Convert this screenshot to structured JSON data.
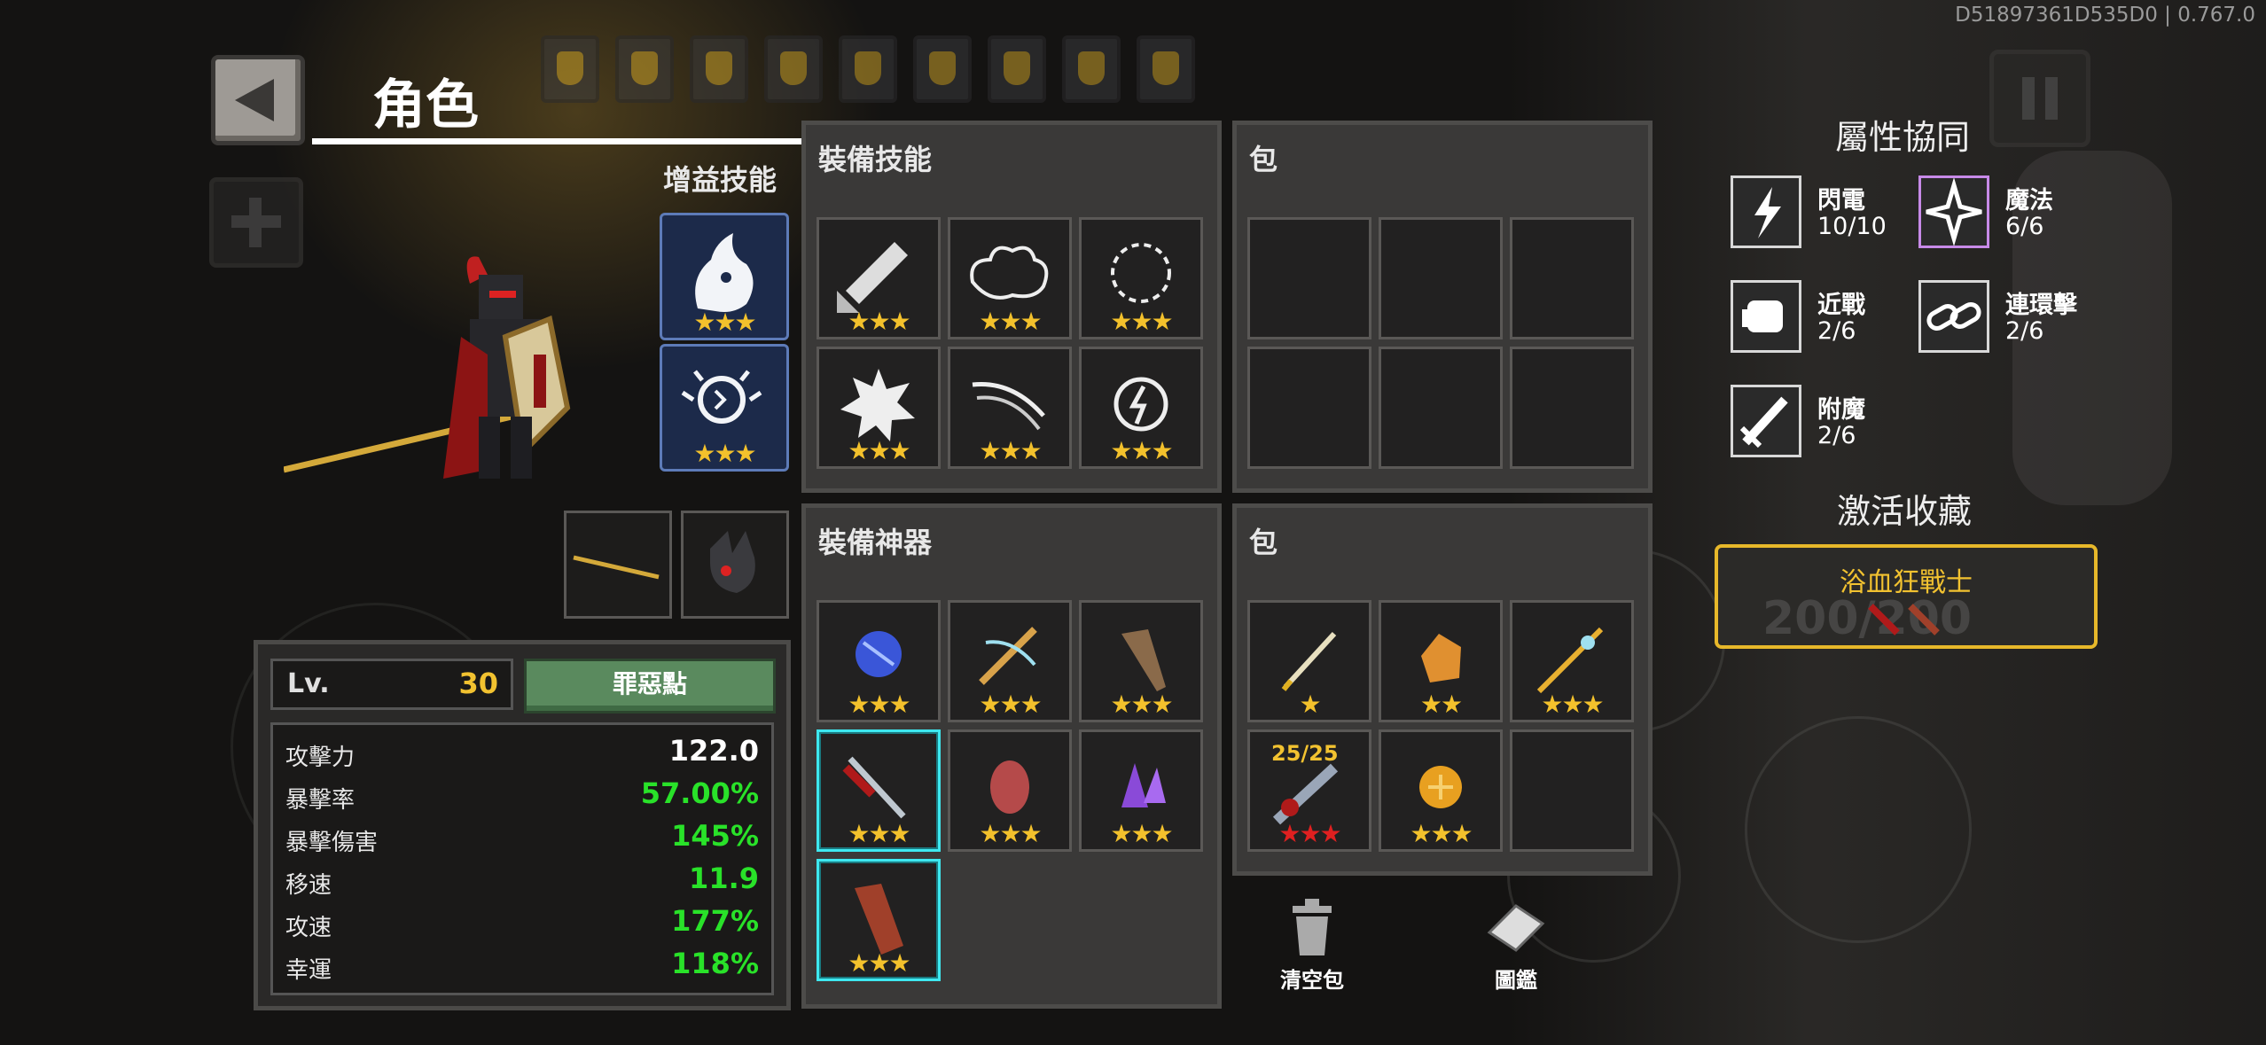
{
  "version_text": "D51897361D535D0 | 0.767.0",
  "screen_title": "角色",
  "buff_skills": {
    "label": "增益技能",
    "slots": [
      {
        "icon": "ghost-flame-icon",
        "stars": "★★★"
      },
      {
        "icon": "spirit-orb-icon",
        "stars": "★★★"
      }
    ]
  },
  "equipped_weapons": [
    {
      "icon": "golden-spear-icon"
    },
    {
      "icon": "shadow-creature-icon"
    }
  ],
  "stats_panel": {
    "level_label": "Lv.",
    "level_value": "30",
    "sin_button": "罪惡點",
    "rows": [
      {
        "name": "攻擊力",
        "value": "122.0",
        "color": "#ffffff"
      },
      {
        "name": "暴擊率",
        "value": "57.00%",
        "color": "#29e229"
      },
      {
        "name": "暴擊傷害",
        "value": "145%",
        "color": "#29e229"
      },
      {
        "name": "移速",
        "value": "11.9",
        "color": "#29e229"
      },
      {
        "name": "攻速",
        "value": "177%",
        "color": "#29e229"
      },
      {
        "name": "幸運",
        "value": "118%",
        "color": "#29e229"
      }
    ]
  },
  "equip_skills": {
    "title": "裝備技能",
    "cells": [
      {
        "icon": "sword-arrow-icon",
        "stars": "★★★"
      },
      {
        "icon": "cloud-burst-icon",
        "stars": "★★★"
      },
      {
        "icon": "energy-ring-icon",
        "stars": "★★★"
      },
      {
        "icon": "spiky-blast-icon",
        "stars": "★★★"
      },
      {
        "icon": "slash-wind-icon",
        "stars": "★★★"
      },
      {
        "icon": "lightning-orb-icon",
        "stars": "★★★"
      }
    ]
  },
  "skill_bag": {
    "title": "包",
    "cells": [
      "",
      "",
      "",
      "",
      "",
      ""
    ]
  },
  "equip_artifacts": {
    "title": "裝備神器",
    "cells": [
      {
        "icon": "blue-crystal-icon",
        "stars": "★★★",
        "selected": false
      },
      {
        "icon": "crossbow-icon",
        "stars": "★★★",
        "selected": false
      },
      {
        "icon": "drill-icon",
        "stars": "★★★",
        "selected": false
      },
      {
        "icon": "blood-sword-icon",
        "stars": "★★★",
        "selected": true
      },
      {
        "icon": "red-egg-icon",
        "stars": "★★★",
        "selected": false
      },
      {
        "icon": "purple-crystal-icon",
        "stars": "★★★",
        "selected": false
      },
      {
        "icon": "leather-glove-icon",
        "stars": "★★★",
        "selected": true
      }
    ]
  },
  "artifact_bag": {
    "title": "包",
    "cells": [
      {
        "icon": "pen-icon",
        "stars": "★",
        "tag": ""
      },
      {
        "icon": "amber-stone-icon",
        "stars": "★★",
        "tag": ""
      },
      {
        "icon": "golden-trident-icon",
        "stars": "★★★",
        "tag": ""
      },
      {
        "icon": "broken-greatsword-icon",
        "stars": "★★★",
        "tag": "25/25",
        "red": true
      },
      {
        "icon": "gold-coin-icon",
        "stars": "★★★",
        "tag": ""
      },
      {
        "icon": "",
        "stars": "",
        "tag": ""
      }
    ]
  },
  "bottom_actions": {
    "clear_bag": "清空包",
    "codex": "圖鑑"
  },
  "synergy": {
    "title": "屬性協同",
    "items": [
      {
        "name": "閃電",
        "count": "10/10",
        "icon": "lightning-icon"
      },
      {
        "name": "魔法",
        "count": "6/6",
        "icon": "magic-star-icon"
      },
      {
        "name": "近戰",
        "count": "2/6",
        "icon": "fist-icon"
      },
      {
        "name": "連環擊",
        "count": "2/6",
        "icon": "chain-icon"
      },
      {
        "name": "附魔",
        "count": "2/6",
        "icon": "enchant-sword-icon"
      }
    ]
  },
  "collection": {
    "title": "激活收藏",
    "name": "浴血狂戰士",
    "progress": "200/200"
  },
  "colors": {
    "accent_gold": "#f2c230",
    "stat_green": "#29e229",
    "select_cyan": "#3ee8f0",
    "sin_button": "#5a8a5e"
  }
}
